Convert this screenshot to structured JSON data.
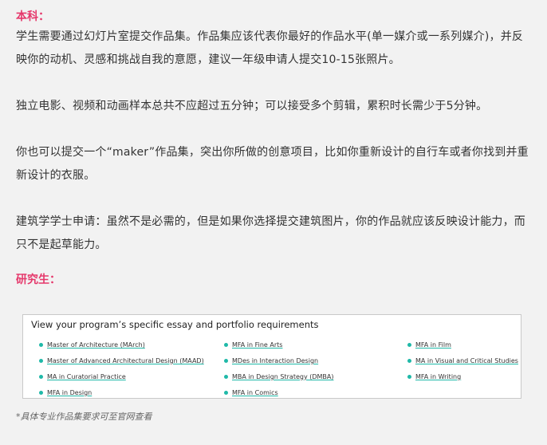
{
  "undergrad": {
    "heading": "本科：",
    "p1": "学生需要通过幻灯片室提交作品集。作品集应该代表你最好的作品水平(单一媒介或一系列媒介)，并反映你的动机、灵感和挑战自我的意愿，建议一年级申请人提交10-15张照片。",
    "p2": "独立电影、视频和动画样本总共不应超过五分钟；可以接受多个剪辑，累积时长需少于5分钟。",
    "p3": "你也可以提交一个“maker”作品集，突出你所做的创意项目，比如你重新设计的自行车或者你找到并重新设计的衣服。",
    "p4": "建筑学学士申请：虽然不是必需的，但是如果你选择提交建筑图片，你的作品就应该反映设计能力，而只不是起草能力。"
  },
  "grad": {
    "heading": "研究生："
  },
  "requirements_box": {
    "title": "View your program’s specific essay and portfolio requirements",
    "columns": [
      [
        "Master of Architecture (MArch)",
        "Master of Advanced Architectural Design (MAAD)",
        "MA in Curatorial Practice",
        "MFA in Design"
      ],
      [
        "MFA in Fine Arts",
        "MDes in Interaction Design",
        "MBA in Design Strategy (DMBA)",
        "MFA in Comics"
      ],
      [
        "MFA in Film",
        "MA in Visual and Critical Studies",
        "MFA in Writing"
      ]
    ],
    "accent_color": "#1fb9a8"
  },
  "footnote": "*具体专业作品集要求可至官网查看",
  "colors": {
    "heading": "#e5386b",
    "background": "#f2f2f2"
  }
}
